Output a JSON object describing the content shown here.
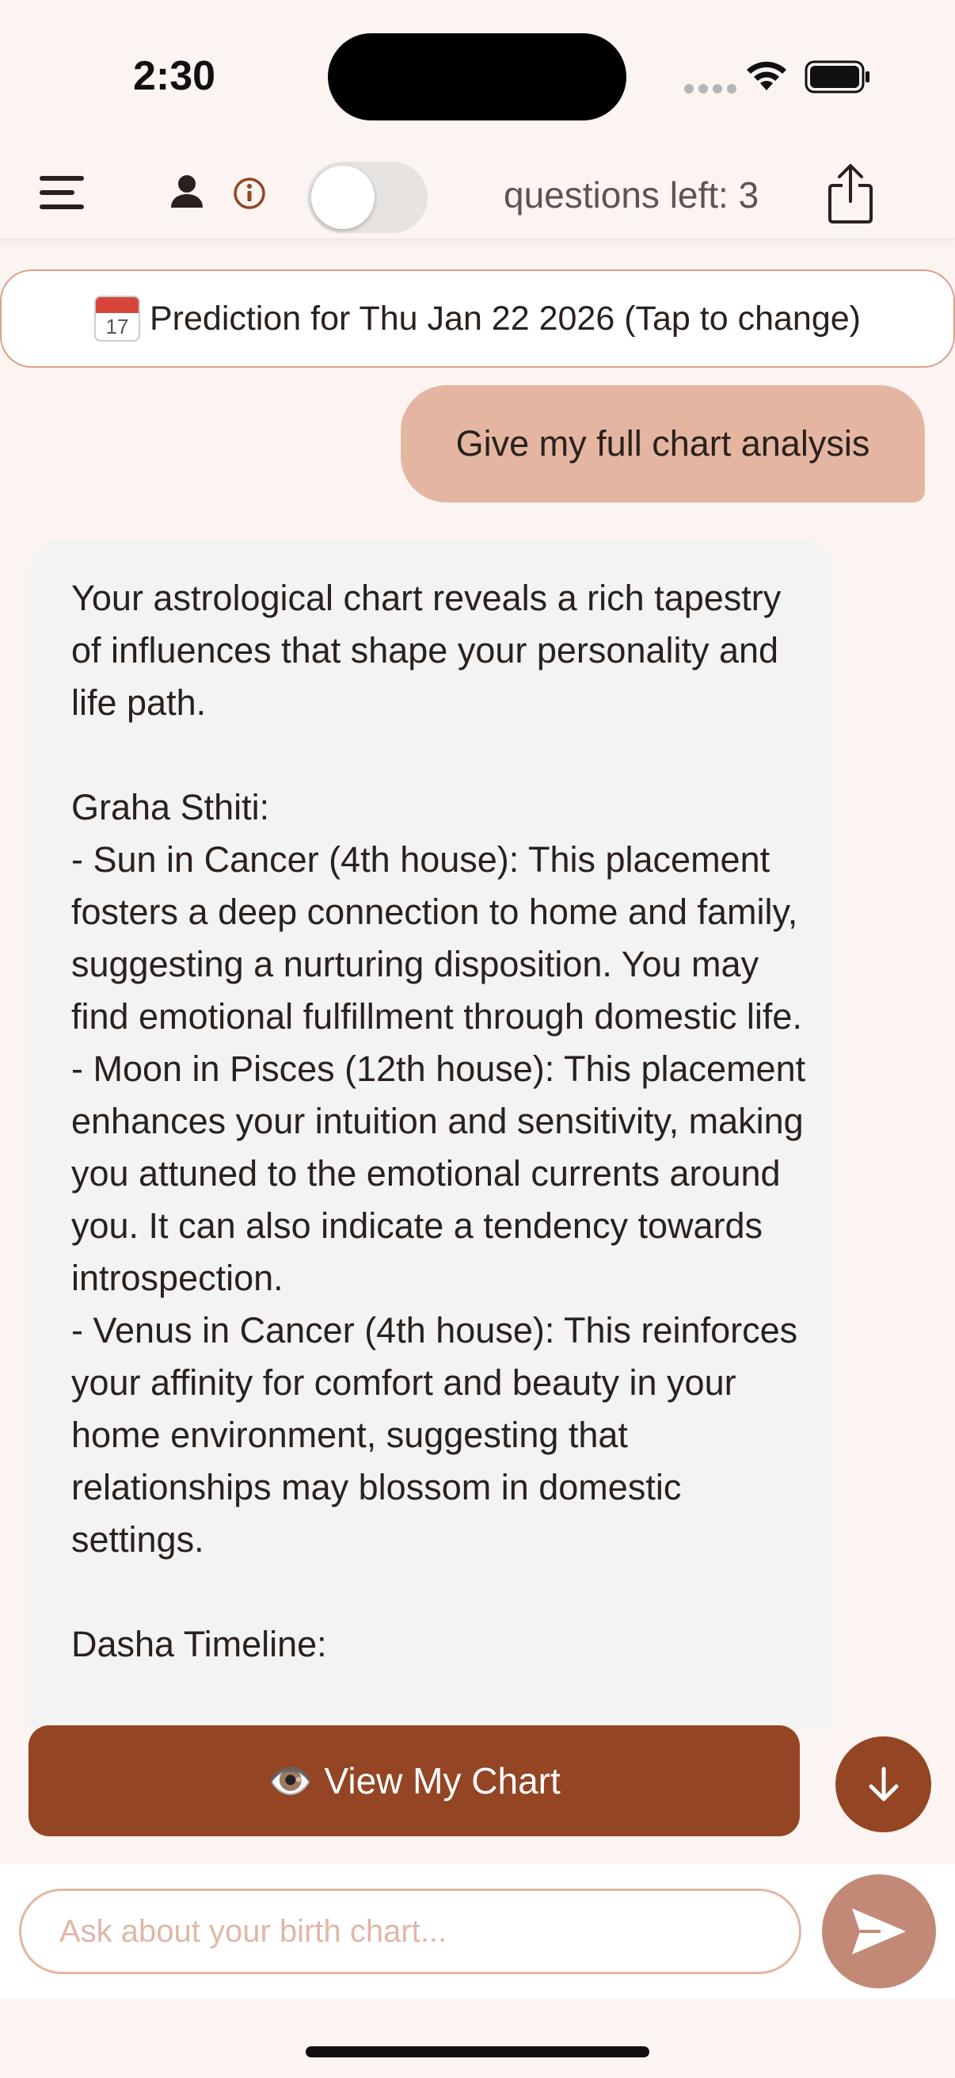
{
  "status_bar": {
    "time": "2:30"
  },
  "header": {
    "questions_left": "questions left: 3",
    "toggle_on": false,
    "icons": [
      "menu-icon",
      "person-icon",
      "info-icon",
      "share-icon"
    ]
  },
  "date_banner": {
    "icon": "calendar-icon",
    "icon_month": "JUL",
    "icon_day": "17",
    "text": "Prediction for Thu Jan 22 2026 (Tap to change)"
  },
  "chat": {
    "user_message": "Give my full chart analysis",
    "ai_message": "Your astrological chart reveals a rich tapestry of influences that shape your personality and life path.\n\nGraha Sthiti:\n- Sun in Cancer (4th house): This placement fosters a deep connection to home and family, suggesting a nurturing disposition. You may find emotional fulfillment through domestic life.\n- Moon in Pisces (12th house): This placement enhances your intuition and sensitivity, making you attuned to the emotional currents around you. It can also indicate a tendency towards introspection.\n- Venus in Cancer (4th house): This reinforces your affinity for comfort and beauty in your home environment, suggesting that relationships may blossom in domestic settings.\n\nDasha Timeline:"
  },
  "actions": {
    "view_chart_emoji": "👁️",
    "view_chart_label": "View My Chart",
    "scroll_down_icon": "arrow-down-icon"
  },
  "input": {
    "placeholder": "Ask about your birth chart...",
    "value": ""
  },
  "colors": {
    "background": "#fcf4f1",
    "accent": "#934524",
    "user_bubble": "#e4b6a2",
    "ai_bubble": "#f3f3f3",
    "send_button": "#c28a76"
  }
}
